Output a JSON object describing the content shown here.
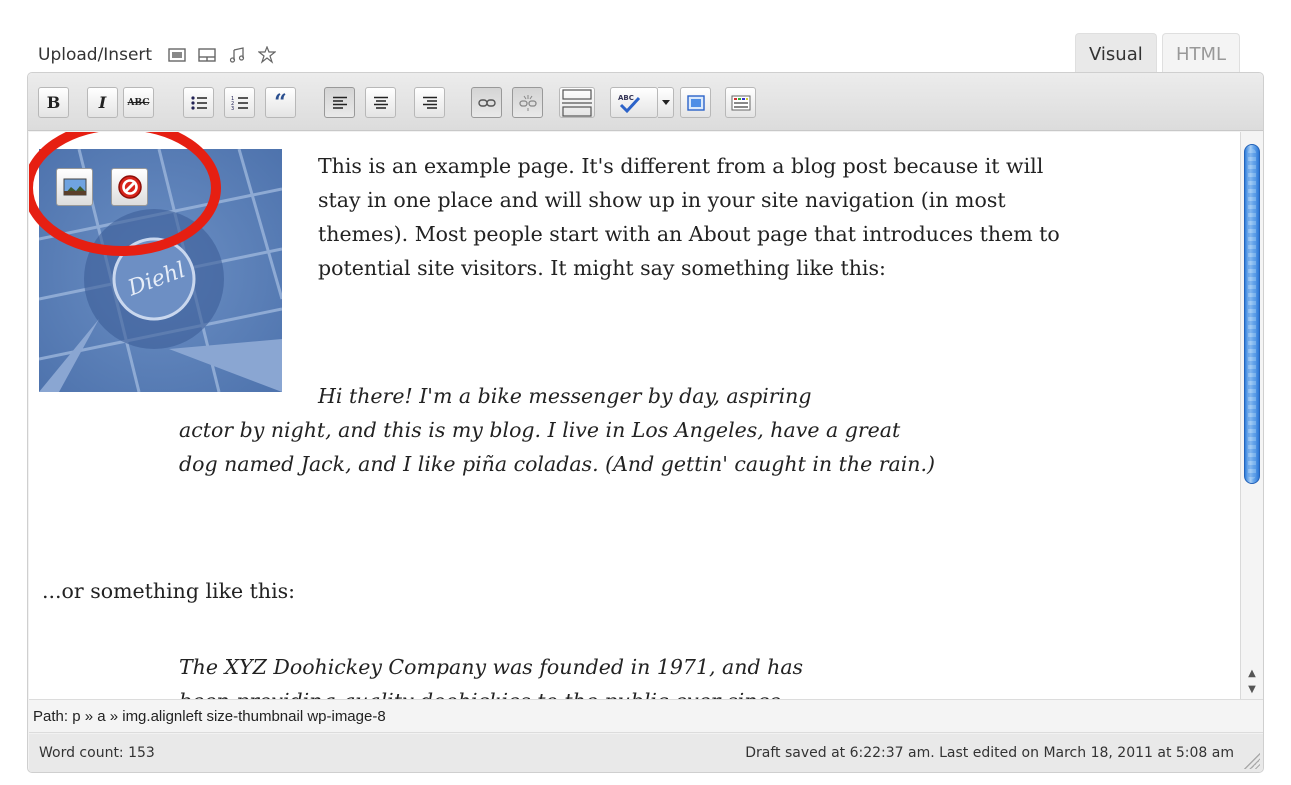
{
  "upload": {
    "label": "Upload/Insert",
    "icons": [
      "add-image-icon",
      "add-video-icon",
      "add-audio-icon",
      "add-media-icon"
    ]
  },
  "tabs": {
    "visual": "Visual",
    "html": "HTML",
    "active": "visual"
  },
  "toolbar": {
    "bold": "B",
    "italic": "I",
    "strike": "ABC",
    "blockquote": "“",
    "buttons": [
      "bold-icon",
      "italic-icon",
      "strikethrough-icon",
      "unordered-list-icon",
      "ordered-list-icon",
      "blockquote-icon",
      "align-left-icon",
      "align-center-icon",
      "align-right-icon",
      "insert-link-icon",
      "unlink-icon",
      "more-tag-icon",
      "spellcheck-icon",
      "dropdown-arrow-icon",
      "fullscreen-icon",
      "kitchen-sink-icon"
    ]
  },
  "content": {
    "p1": "This is an example page. It's different from a blog post because it will stay in one place and will show up in your site navigation (in most themes). Most people start with an About page that introduces them to potential site visitors. It might say something like this:",
    "quote1_first": "Hi there! I'm a bike messenger by day, aspiring",
    "quote1_rest": "actor by night, and this is my blog. I live in Los Angeles, have a great dog named Jack, and I like piña coladas. (And gettin' caught in the rain.)",
    "p2": "...or something like this:",
    "quote2_first": "The XYZ Doohickey Company was founded in 1971, and has",
    "quote2_cut": "been providing quality doohickies to the public ever since."
  },
  "image": {
    "alt_text": "Diehl",
    "edit_icon": "edit-image-icon",
    "delete_icon": "delete-image-icon",
    "highlight_color": "#e61f12"
  },
  "path": {
    "text": "Path: p » a » img.alignleft size-thumbnail wp-image-8"
  },
  "status": {
    "word_count": "Word count: 153",
    "draft": "Draft saved at 6:22:37 am. Last edited on March 18, 2011 at 5:08 am"
  },
  "colors": {
    "scroll_thumb": "#3b84e0",
    "toolbar_bg": "#e2e2e2"
  }
}
